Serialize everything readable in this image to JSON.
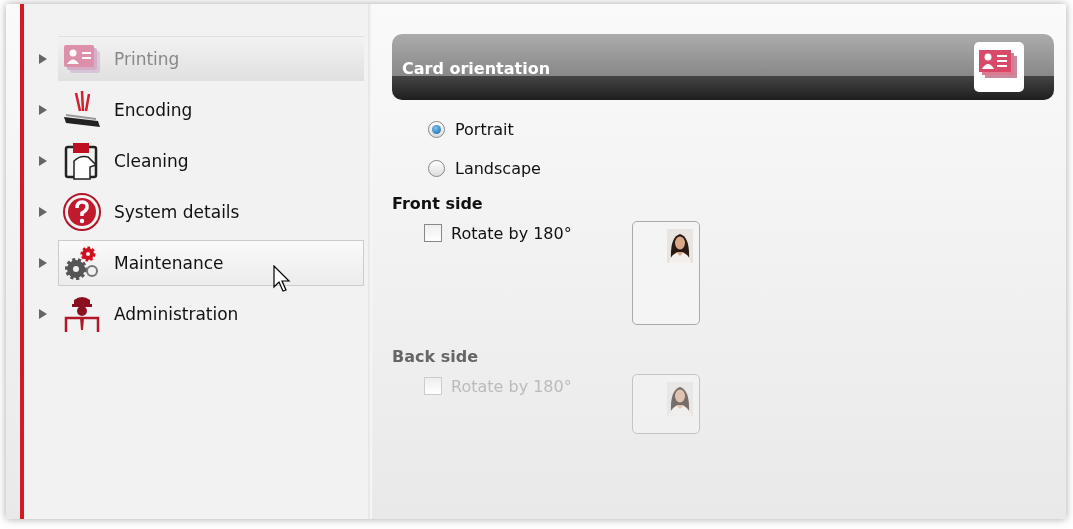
{
  "sidebar": {
    "items": [
      {
        "label": "Printing",
        "kind": "printing",
        "selected": true,
        "hovered": false
      },
      {
        "label": "Encoding",
        "kind": "encoding",
        "selected": false,
        "hovered": false
      },
      {
        "label": "Cleaning",
        "kind": "cleaning",
        "selected": false,
        "hovered": false
      },
      {
        "label": "System details",
        "kind": "help",
        "selected": false,
        "hovered": false
      },
      {
        "label": "Maintenance",
        "kind": "maintenance",
        "selected": false,
        "hovered": true
      },
      {
        "label": "Administration",
        "kind": "admin",
        "selected": false,
        "hovered": false
      }
    ]
  },
  "panel": {
    "title": "Card orientation",
    "orientation": [
      {
        "label": "Portrait",
        "selected": true
      },
      {
        "label": "Landscape",
        "selected": false
      }
    ],
    "sides": [
      {
        "title": "Front side",
        "disabled": false,
        "rotate": {
          "label": "Rotate by 180°",
          "checked": false
        }
      },
      {
        "title": "Back side",
        "disabled": true,
        "rotate": {
          "label": "Rotate by 180°",
          "checked": false
        }
      }
    ]
  }
}
